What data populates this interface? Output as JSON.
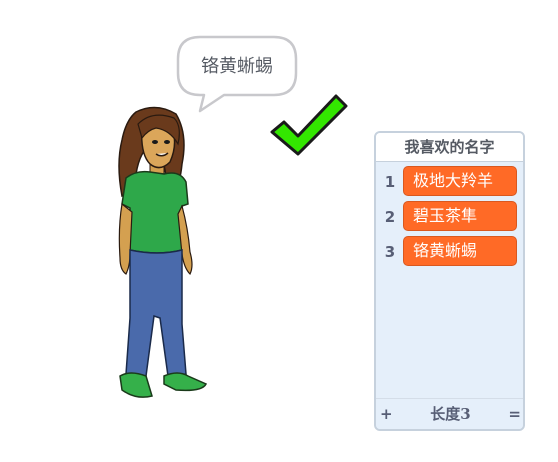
{
  "stage": {
    "speech_bubble": {
      "text": "铬黄蜥蜴"
    },
    "sprite": {
      "name": "girl-sprite",
      "icon": "checkmark-icon"
    },
    "colors": {
      "check_fill": "#33e600",
      "check_stroke": "#1a1a1a",
      "list_item": "#ff6a26",
      "list_bg": "#e5effa"
    }
  },
  "list_monitor": {
    "title": "我喜欢的名字",
    "items": [
      {
        "index": "1",
        "value": "极地大羚羊"
      },
      {
        "index": "2",
        "value": "碧玉茶隼"
      },
      {
        "index": "3",
        "value": "铬黄蜥蜴"
      }
    ],
    "footer": {
      "add_label": "+",
      "length_label": "长度3",
      "resize_label": "="
    }
  }
}
